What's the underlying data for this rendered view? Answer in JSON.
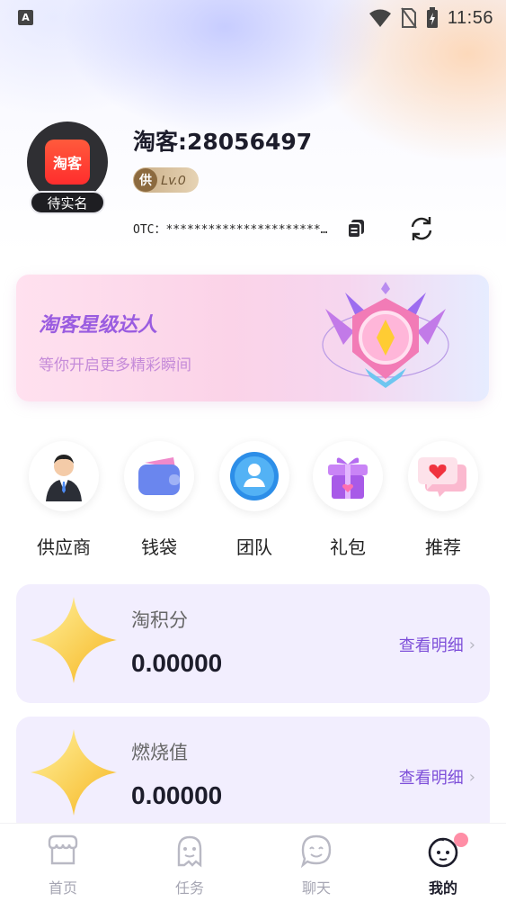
{
  "status_bar": {
    "left_icon_letter": "A",
    "time": "11:56",
    "icons": [
      "wifi-icon",
      "no-sim-icon",
      "battery-charging-icon"
    ]
  },
  "profile": {
    "avatar_logo": "淘客",
    "avatar_badge": "待实名",
    "name": "淘客:28056497",
    "level_icon_char": "供",
    "level": "Lv.0",
    "otc": "OTC：************************…",
    "copy_icon": "copy-icon",
    "refresh_icon": "refresh-icon"
  },
  "banner": {
    "title": "淘客星级达人",
    "subtitle": "等你开启更多精彩瞬间",
    "image_icon": "medal-icon"
  },
  "quick_menu": [
    {
      "label": "供应商",
      "icon": "supplier-icon"
    },
    {
      "label": "钱袋",
      "icon": "wallet-icon"
    },
    {
      "label": "团队",
      "icon": "team-icon"
    },
    {
      "label": "礼包",
      "icon": "gift-icon"
    },
    {
      "label": "推荐",
      "icon": "recommend-icon"
    }
  ],
  "cards": [
    {
      "title": "淘积分",
      "value": "0.00000",
      "link": "查看明细",
      "icon": "star-icon"
    },
    {
      "title": "燃烧值",
      "value": "0.00000",
      "link": "查看明细",
      "icon": "star-icon"
    }
  ],
  "tabs": [
    {
      "label": "首页",
      "icon": "store-icon",
      "active": false
    },
    {
      "label": "任务",
      "icon": "ghost-icon",
      "active": false
    },
    {
      "label": "聊天",
      "icon": "chat-face-icon",
      "active": false
    },
    {
      "label": "我的",
      "icon": "profile-face-icon",
      "active": true
    }
  ],
  "colors": {
    "accent": "#7d4ed9",
    "banner_title": "#9a5ce0",
    "card_bg": "#f2eefe",
    "notification_dot": "#ff8ea6"
  }
}
